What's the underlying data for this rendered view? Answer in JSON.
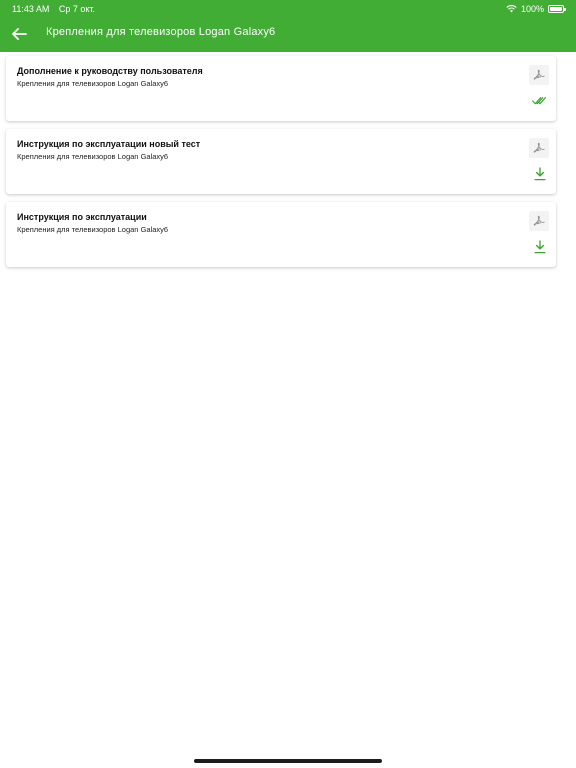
{
  "status_bar": {
    "time": "11:43 AM",
    "date": "Ср 7 окт.",
    "battery": "100%"
  },
  "nav": {
    "title": "Крепления для телевизоров Logan Galaxy6"
  },
  "colors": {
    "brand_green": "#41ad35",
    "icon_green": "#3aa52e",
    "icon_gray": "#8a8a8a"
  },
  "documents": [
    {
      "title": "Дополнение к руководству пользователя",
      "subtitle": "Крепления для телевизоров Logan Galaxy6",
      "file_icon": "pdf-icon",
      "status_icon": "downloaded-check-icon"
    },
    {
      "title": "Инструкция по эксплуатации новый тест",
      "subtitle": "Крепления для телевизоров Logan Galaxy6",
      "file_icon": "pdf-icon",
      "status_icon": "download-icon"
    },
    {
      "title": "Инструкция по  эксплуатации",
      "subtitle": "Крепления для телевизоров Logan Galaxy6",
      "file_icon": "pdf-icon",
      "status_icon": "download-icon"
    }
  ]
}
